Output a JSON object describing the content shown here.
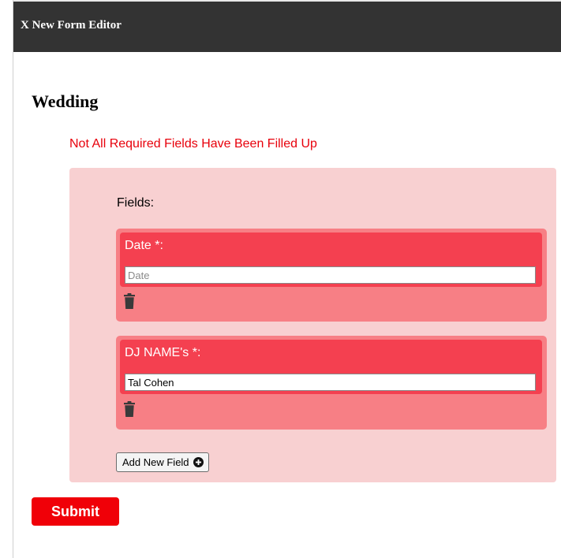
{
  "window": {
    "title": "X New Form Editor"
  },
  "form": {
    "title": "Wedding",
    "error_message": "Not All Required Fields Have Been Filled Up",
    "fields_label": "Fields:",
    "fields": [
      {
        "label": "Date *:",
        "value": "",
        "placeholder": "Date",
        "delete_icon": "trash-icon"
      },
      {
        "label": "DJ NAME's *:",
        "value": "Tal Cohen",
        "placeholder": "",
        "delete_icon": "trash-icon"
      }
    ],
    "add_field_label": "Add New Field",
    "add_field_icon": "plus-circle-icon",
    "submit_label": "Submit"
  },
  "colors": {
    "titlebar": "#333333",
    "error_text": "#e8000b",
    "panel_bg": "#f8d0d1",
    "field_card_bg": "#f77f85",
    "field_head_bg": "#f44050",
    "submit_bg": "#f00008"
  }
}
